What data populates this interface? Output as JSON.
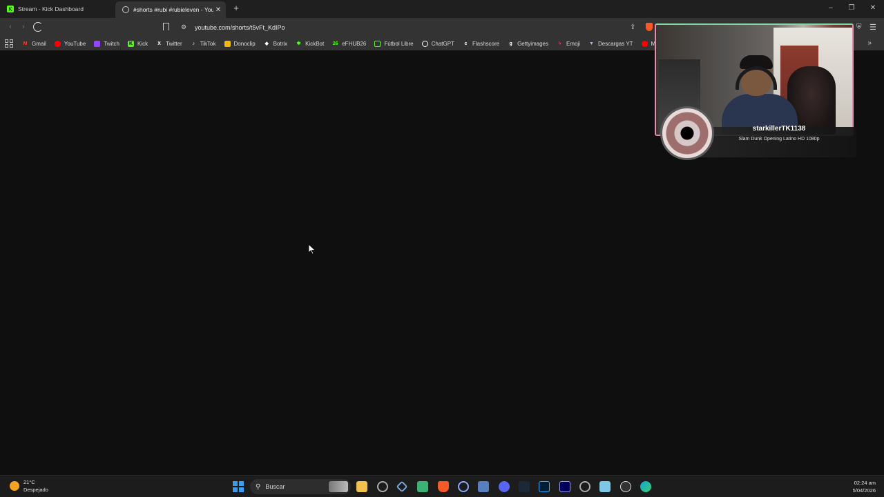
{
  "tabs": [
    {
      "label": "Stream - Kick Dashboard",
      "icon": "kick-icon",
      "active": false
    },
    {
      "label": "#shorts #rubi #rubieleven - YouT",
      "icon": "globe-icon",
      "active": true
    }
  ],
  "address_bar": {
    "url": "youtube.com/shorts/t5vFt_KdIPo"
  },
  "bookmarks": [
    {
      "label": "Gmail",
      "icon": "gmail-icon",
      "color": "#ea4335"
    },
    {
      "label": "YouTube",
      "icon": "youtube-icon",
      "color": "#ff0000"
    },
    {
      "label": "Twitch",
      "icon": "twitch-icon",
      "color": "#9146ff"
    },
    {
      "label": "Kick",
      "icon": "kick-icon",
      "color": "#53fc18"
    },
    {
      "label": "Twitter",
      "icon": "x-icon",
      "color": "#ffffff"
    },
    {
      "label": "TikTok",
      "icon": "tiktok-icon",
      "color": "#ffffff"
    },
    {
      "label": "Donoclip",
      "icon": "donoclip-icon",
      "color": "#f5b800"
    },
    {
      "label": "Botrix",
      "icon": "botrix-icon",
      "color": "#ffffff"
    },
    {
      "label": "KickBot",
      "icon": "kickbot-icon",
      "color": "#53fc18"
    },
    {
      "label": "eFHUB26",
      "icon": "efhub-icon",
      "color": "#53fc18"
    },
    {
      "label": "Fútbol Libre",
      "icon": "futbol-icon",
      "color": "#53fc18"
    },
    {
      "label": "ChatGPT",
      "icon": "chatgpt-icon",
      "color": "#ffffff"
    },
    {
      "label": "Flashscore",
      "icon": "flashscore-icon",
      "color": "#ffffff"
    },
    {
      "label": "Gettyimages",
      "icon": "getty-icon",
      "color": "#ffffff"
    },
    {
      "label": "Emoji",
      "icon": "emoji-icon",
      "color": "#ff3355"
    },
    {
      "label": "Descargas YT",
      "icon": "download-icon",
      "color": "#c8a0f0"
    },
    {
      "label": "Mix N",
      "icon": "youtube-icon",
      "color": "#ff0000"
    }
  ],
  "overlay": {
    "username": "starkillerTK1138",
    "song": "Slam Dunk Opening Latino HD 1080p"
  },
  "taskbar": {
    "weather_temp": "21°C",
    "weather_desc": "Despejado",
    "search_placeholder": "Buscar",
    "time": "02:24 am",
    "date": "5/04/2026"
  }
}
